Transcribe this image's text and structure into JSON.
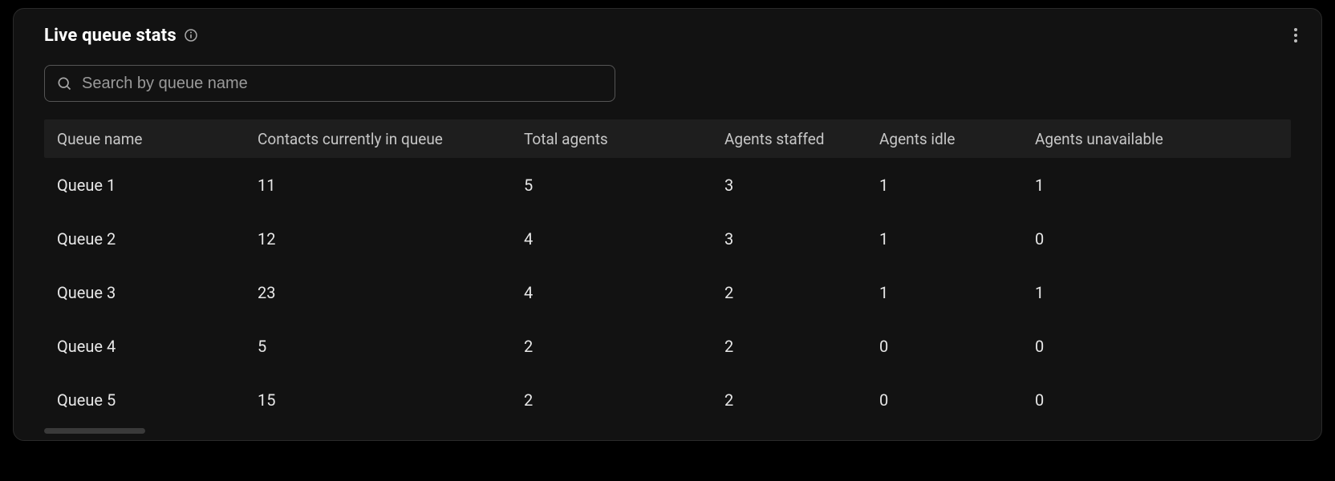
{
  "panel": {
    "title": "Live queue stats",
    "search": {
      "placeholder": "Search by queue name"
    }
  },
  "table": {
    "columns": [
      "Queue name",
      "Contacts currently in queue",
      "Total agents",
      "Agents staffed",
      "Agents idle",
      "Agents unavailable"
    ],
    "rows": [
      {
        "name": "Queue 1",
        "contacts": "11",
        "total": "5",
        "staffed": "3",
        "idle": "1",
        "unavailable": "1"
      },
      {
        "name": "Queue 2",
        "contacts": "12",
        "total": "4",
        "staffed": "3",
        "idle": "1",
        "unavailable": "0"
      },
      {
        "name": "Queue 3",
        "contacts": "23",
        "total": "4",
        "staffed": "2",
        "idle": "1",
        "unavailable": "1"
      },
      {
        "name": "Queue 4",
        "contacts": "5",
        "total": "2",
        "staffed": "2",
        "idle": "0",
        "unavailable": "0"
      },
      {
        "name": "Queue 5",
        "contacts": "15",
        "total": "2",
        "staffed": "2",
        "idle": "0",
        "unavailable": "0"
      }
    ]
  }
}
